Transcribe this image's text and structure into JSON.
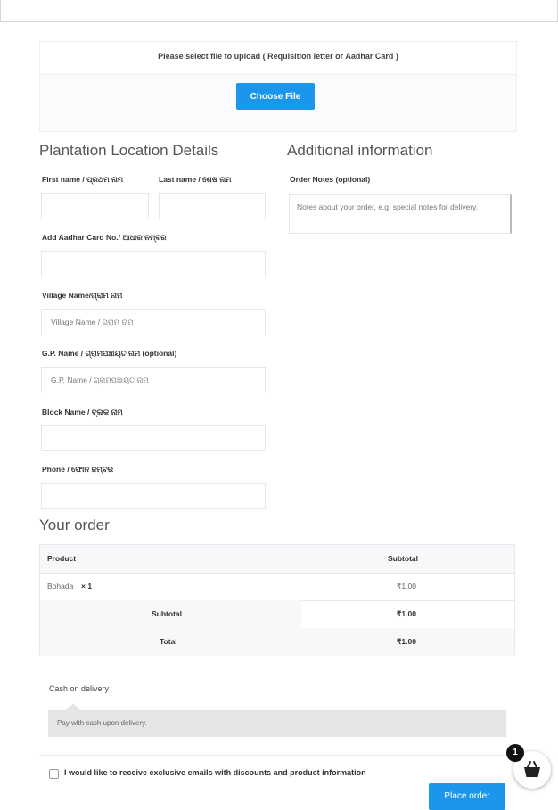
{
  "upload": {
    "title": "Please select file to upload ( Requisition letter or Aadhar Card )",
    "button_label": "Choose File"
  },
  "plantation": {
    "heading": "Plantation Location Details",
    "first_name_label": "First name / ପ୍ରଥମ ନାମ",
    "last_name_label": "Last name / ଶେଷ ନାମ",
    "aadhar_label": "Add Aadhar Card No./ ଆଧାର ନମ୍ବର",
    "village_label": "Village Name/ଗ୍ରାମ ନାମ",
    "village_placeholder": "Village Name / ଗ୍ରାମ ନାମ",
    "gp_label": "G.P. Name / ଗ୍ରାମପଞ୍ଚାୟତ ନାମ  (optional)",
    "gp_placeholder": "G.P. Name / ଗ୍ରାମପଞ୍ଚାୟତ ନାମ",
    "block_label": "Block Name / ବ୍ଲକ ନାମ",
    "phone_label": "Phone / ଫୋନ ନମ୍ବର"
  },
  "additional": {
    "heading": "Additional information",
    "notes_label": "Order Notes (optional)",
    "notes_placeholder": "Notes about your order, e.g. special notes for delivery."
  },
  "order": {
    "heading": "Your order",
    "col_product": "Product",
    "col_subtotal": "Subtotal",
    "item_name": "Bohada",
    "item_qty": "× 1",
    "item_price": "₹1.00",
    "subtotal_label": "Subtotal",
    "subtotal_value": "₹1.00",
    "total_label": "Total",
    "total_value": "₹1.00"
  },
  "payment": {
    "method": "Cash on delivery",
    "description": "Pay with cash upon delivery."
  },
  "consent_text": "I would like to receive exclusive emails with discounts and product information",
  "place_order_label": "Place order",
  "cart": {
    "count": "1",
    "icon": "basket-icon"
  },
  "colors": {
    "accent": "#1a97ea",
    "badge": "#111111"
  }
}
